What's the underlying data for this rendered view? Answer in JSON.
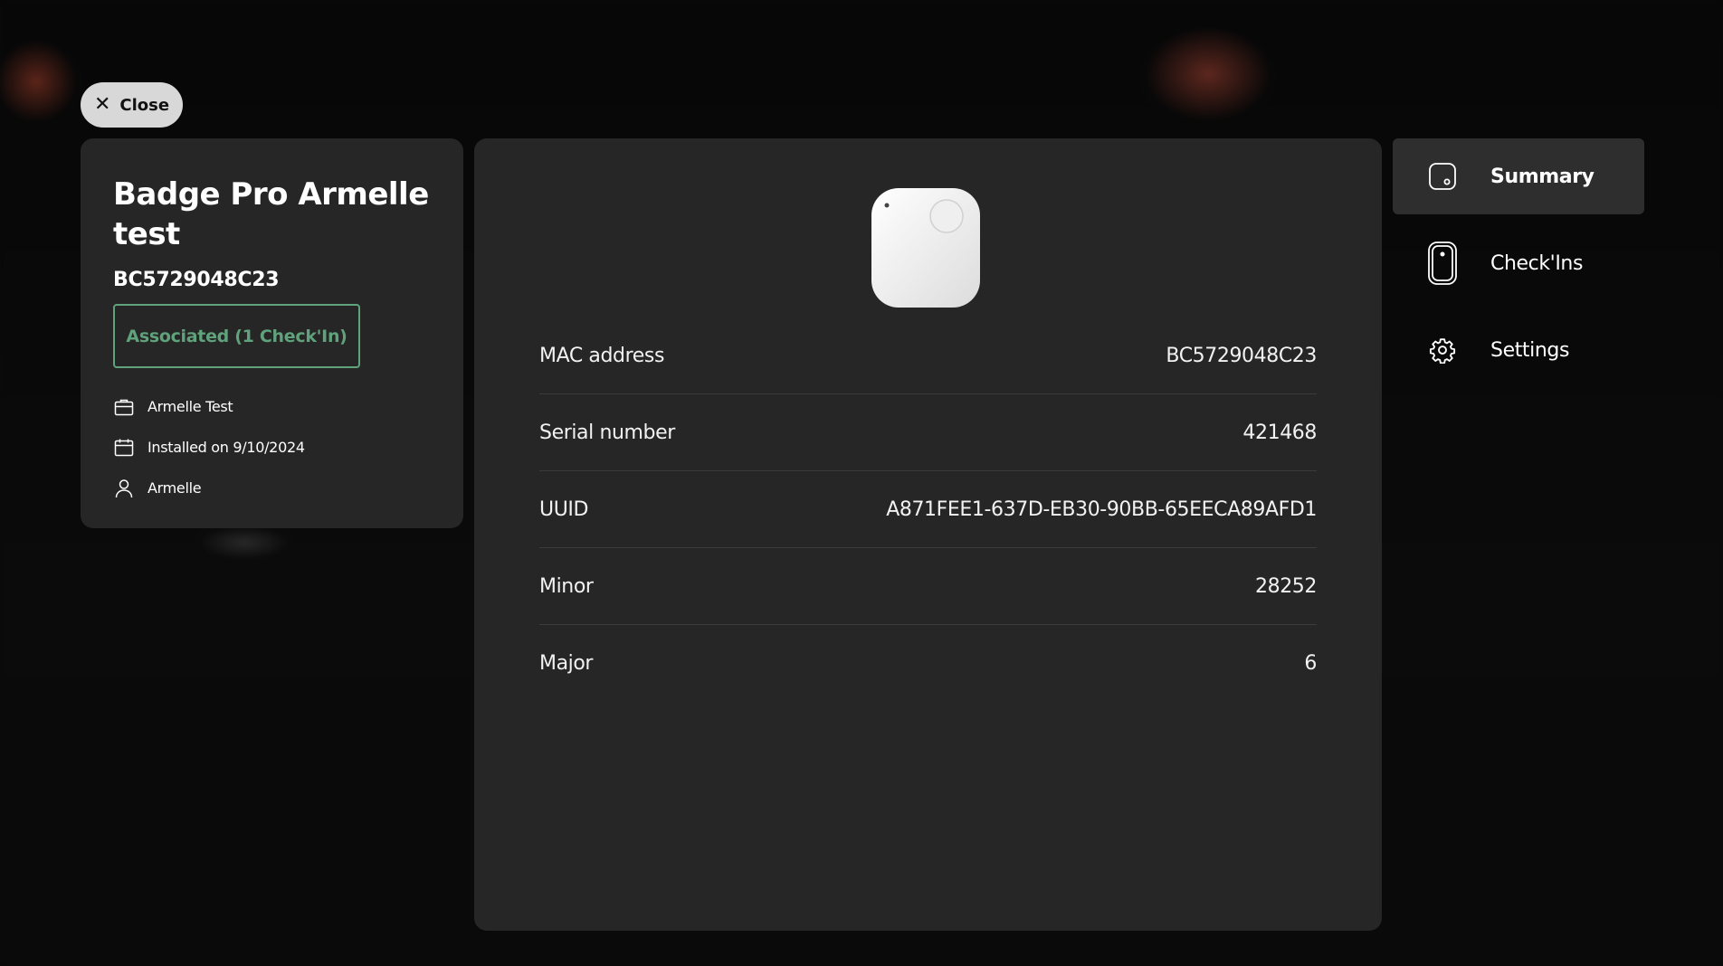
{
  "close_button": {
    "label": "Close",
    "icon": "close-icon"
  },
  "device": {
    "title": "Badge Pro Armelle test",
    "identifier": "BC5729048C23",
    "status": "Associated (1 Check'In)",
    "status_color": "#5fa27c",
    "meta": [
      {
        "icon": "briefcase-icon",
        "text": "Armelle Test"
      },
      {
        "icon": "calendar-icon",
        "text": "Installed on 9/10/2024"
      },
      {
        "icon": "user-icon",
        "text": "Armelle"
      }
    ]
  },
  "details": [
    {
      "label": "MAC address",
      "value": "BC5729048C23"
    },
    {
      "label": "Serial number",
      "value": "421468"
    },
    {
      "label": "UUID",
      "value": "A871FEE1-637D-EB30-90BB-65EECA89AFD1"
    },
    {
      "label": "Minor",
      "value": "28252"
    },
    {
      "label": "Major",
      "value": "6"
    }
  ],
  "nav": {
    "items": [
      {
        "label": "Summary",
        "icon": "badge-device-icon",
        "active": true
      },
      {
        "label": "Check'Ins",
        "icon": "phone-tag-icon",
        "active": false
      },
      {
        "label": "Settings",
        "icon": "gear-icon",
        "active": false
      }
    ]
  },
  "colors": {
    "card_background": "#262626",
    "page_background": "#0a0a0a",
    "accent_green": "#5fa27c",
    "nav_active_background": "#2e2e2e"
  }
}
